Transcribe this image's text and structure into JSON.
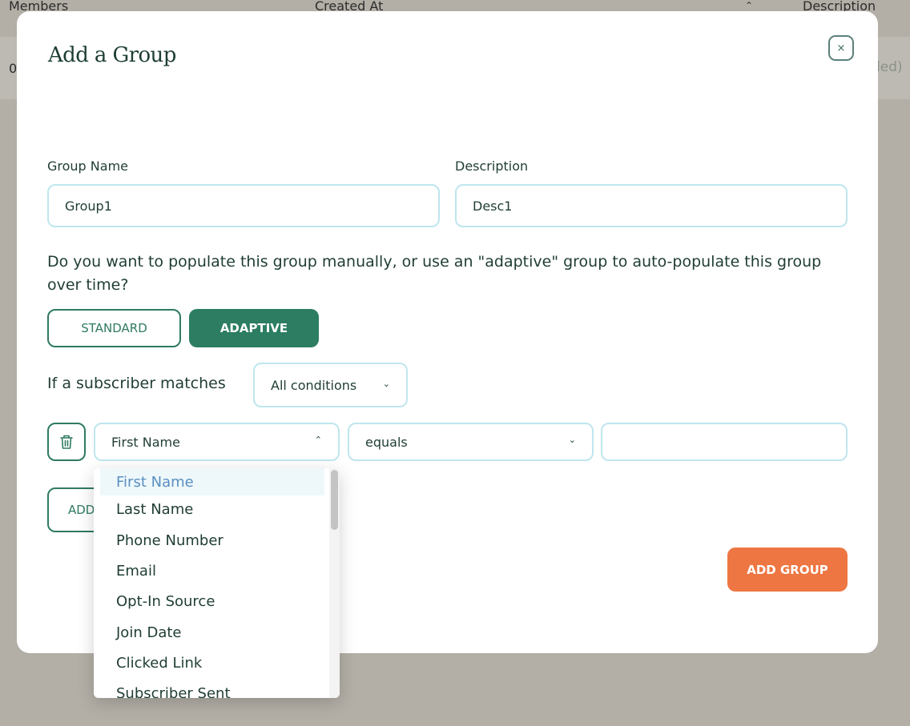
{
  "background": {
    "columns": [
      "Members",
      "Created At",
      "Description"
    ],
    "row_cells": [
      "0",
      "ded)"
    ]
  },
  "modal": {
    "title": "Add a Group",
    "close_symbol": "×",
    "group_name": {
      "label": "Group Name",
      "value": "Group1"
    },
    "description": {
      "label": "Description",
      "value": "Desc1"
    },
    "question": "Do you want to populate this group manually, or use an \"adaptive\" group to auto-populate this group over time?",
    "type_buttons": {
      "standard": "STANDARD",
      "adaptive": "ADAPTIVE"
    },
    "selected_type": "ADAPTIVE",
    "match_label": "If a subscriber matches",
    "match_select": "All conditions",
    "condition": {
      "field": "First Name",
      "operator": "equals",
      "value": ""
    },
    "add_condition_partial": "ADD",
    "add_group": "ADD GROUP"
  },
  "dropdown": {
    "items": [
      "First Name",
      "Last Name",
      "Phone Number",
      "Email",
      "Opt-In Source",
      "Join Date",
      "Clicked Link",
      "Subscriber Sent"
    ],
    "selected": "First Name"
  },
  "icons": {
    "close": "close-icon",
    "trash": "trash-icon",
    "chevron_down": "chevron-down-icon",
    "chevron_up": "chevron-up-icon",
    "sort": "sort-icon"
  },
  "colors": {
    "accent": "#2c7d62",
    "orange": "#ee7642",
    "input_border": "#bfe6ee",
    "overlay": "#b3afa7"
  }
}
